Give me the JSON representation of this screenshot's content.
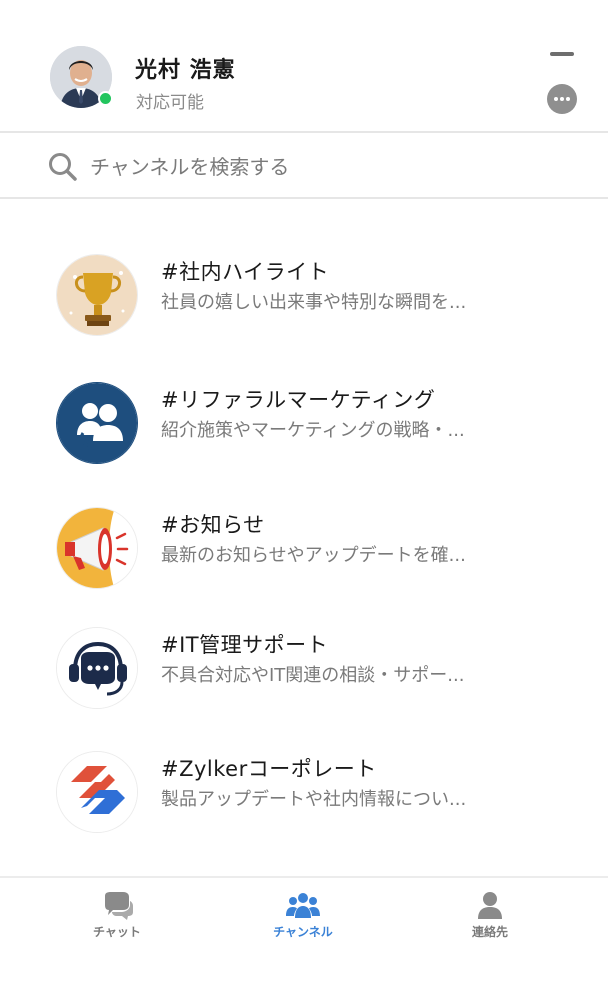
{
  "user": {
    "name": "光村 浩憲",
    "status": "対応可能",
    "presence_color": "#22c55e"
  },
  "header": {
    "minimize_icon": "minimize-icon",
    "more_icon": "more-options-icon"
  },
  "search": {
    "placeholder": "チャンネルを検索する",
    "value": ""
  },
  "channels": [
    {
      "name": "#社内ハイライト",
      "description": "社員の嬉しい出来事や特別な瞬間を...",
      "icon": "trophy-icon"
    },
    {
      "name": "#リファラルマーケティング",
      "description": "紹介施策やマーケティングの戦略・...",
      "icon": "referral-users-icon"
    },
    {
      "name": "#お知らせ",
      "description": "最新のお知らせやアップデートを確...",
      "icon": "megaphone-icon"
    },
    {
      "name": "#IT管理サポート",
      "description": "不具合対応やIT関連の相談・サポー...",
      "icon": "headset-icon"
    },
    {
      "name": "#Zylkerコーポレート",
      "description": "製品アップデートや社内情報につい...",
      "icon": "zylker-logo-icon"
    }
  ],
  "nav": {
    "items": [
      {
        "label": "チャット",
        "icon": "chat-bubbles-icon",
        "active": false
      },
      {
        "label": "チャンネル",
        "icon": "group-icon",
        "active": true
      },
      {
        "label": "連絡先",
        "icon": "contact-person-icon",
        "active": false
      }
    ],
    "active_color": "#3b82d6",
    "inactive_color": "#8a8a8a"
  }
}
